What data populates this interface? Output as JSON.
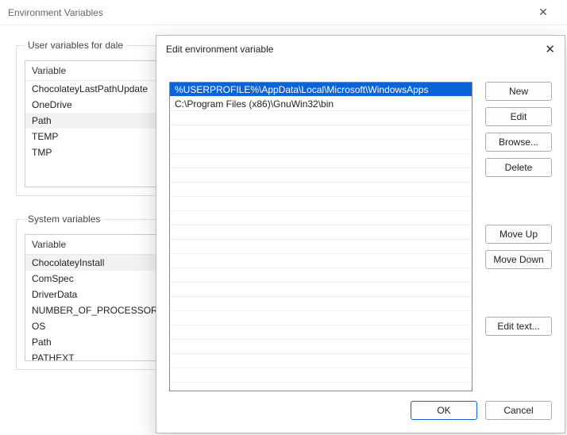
{
  "window": {
    "title": "Environment Variables",
    "close_glyph": "✕"
  },
  "user_vars": {
    "legend": "User variables for dale",
    "header": "Variable",
    "rows": [
      {
        "name": "ChocolateyLastPathUpdate",
        "selected": false
      },
      {
        "name": "OneDrive",
        "selected": false
      },
      {
        "name": "Path",
        "selected": true
      },
      {
        "name": "TEMP",
        "selected": false
      },
      {
        "name": "TMP",
        "selected": false
      }
    ]
  },
  "system_vars": {
    "legend": "System variables",
    "header": "Variable",
    "rows": [
      {
        "name": "ChocolateyInstall",
        "selected": true
      },
      {
        "name": "ComSpec",
        "selected": false
      },
      {
        "name": "DriverData",
        "selected": false
      },
      {
        "name": "NUMBER_OF_PROCESSORS",
        "selected": false
      },
      {
        "name": "OS",
        "selected": false
      },
      {
        "name": "Path",
        "selected": false
      },
      {
        "name": "PATHEXT",
        "selected": false
      }
    ]
  },
  "dialog": {
    "title": "Edit environment variable",
    "close_glyph": "✕",
    "entries": [
      {
        "value": "%USERPROFILE%\\AppData\\Local\\Microsoft\\WindowsApps",
        "selected": true
      },
      {
        "value": "C:\\Program Files (x86)\\GnuWin32\\bin",
        "selected": false
      }
    ],
    "buttons": {
      "new": "New",
      "edit": "Edit",
      "browse": "Browse...",
      "delete": "Delete",
      "move_up": "Move Up",
      "move_down": "Move Down",
      "edit_text": "Edit text...",
      "ok": "OK",
      "cancel": "Cancel"
    }
  }
}
